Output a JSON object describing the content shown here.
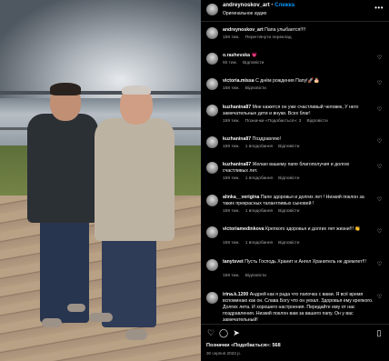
{
  "header": {
    "username": "andreynoskov_art",
    "dot": "•",
    "follow_label": "Слежка",
    "subtitle": "Оригинальное аудио",
    "more_icon": "more-horizontal-icon"
  },
  "comments": [
    {
      "user": "andreynoskov_art",
      "text": "Папа улыбается!!!!",
      "meta": [
        "159 тиж.",
        "Переглянути переклад"
      ]
    },
    {
      "user": "o.rashevska",
      "text": "💗",
      "meta": [
        "92 тиж.",
        "Відповісти"
      ]
    },
    {
      "user": "victoria.missa",
      "text": "С днём рождения Папу!🚀🎂",
      "meta": [
        "158 тиж.",
        "Відповісти"
      ]
    },
    {
      "user": "kuzhanina87",
      "text": "Мне кажется он уже счастливый человек, У него замечательные дети и внуки. Всех благ!",
      "meta": [
        "159 тиж.",
        "Позначки «Подобається»: 3",
        "Відповісти"
      ]
    },
    {
      "user": "kuzhanina87",
      "text": "Поздравляю!",
      "meta": [
        "159 тиж.",
        "1 вподобання",
        "Відповісти"
      ]
    },
    {
      "user": "kuzhanina87",
      "text": "Желаю вашему папе благополучия и долгих счастливых лет.",
      "meta": [
        "159 тиж.",
        "1 вподобання",
        "Відповісти"
      ]
    },
    {
      "user": "alinka__verigina",
      "text": "Папе здоровья и долгих лет ! Низкий поклон за таких прекрасных талантливых сыновей !",
      "meta": [
        "159 тиж.",
        "1 вподобання",
        "Відповісти"
      ]
    },
    {
      "user": "victoriamedinkova",
      "text": "Крепкого здоровья и долгих лет жизни!!! 👏",
      "meta": [
        "159 тиж.",
        "1 вподобання",
        "Відповісти"
      ]
    },
    {
      "user": "tanytsvet",
      "text": "Пусть Господь Хранит и Ангел Хранитель не дремлет!!!",
      "meta": [
        "159 тиж.",
        "Відповісти"
      ]
    },
    {
      "user": "irina.k.1200",
      "text": "Андрей как я рада что папочка с вами. Я всё время вспоминаю как он. Слава Богу что он уехал. Здоровья ему крепкого. Долгих лета. И хорошего настроения. Передайте ему от нас поздравления. Низкий поклон вам за вашего папу. Он у вас замечательный!",
      "meta": []
    }
  ],
  "actions": {
    "like_icon": "heart-icon",
    "comment_icon": "comment-icon",
    "share_icon": "share-icon",
    "save_icon": "bookmark-icon"
  },
  "likes_text": "Позначки «Подобається»: 568",
  "date_text": "30 серпня 2023 р."
}
